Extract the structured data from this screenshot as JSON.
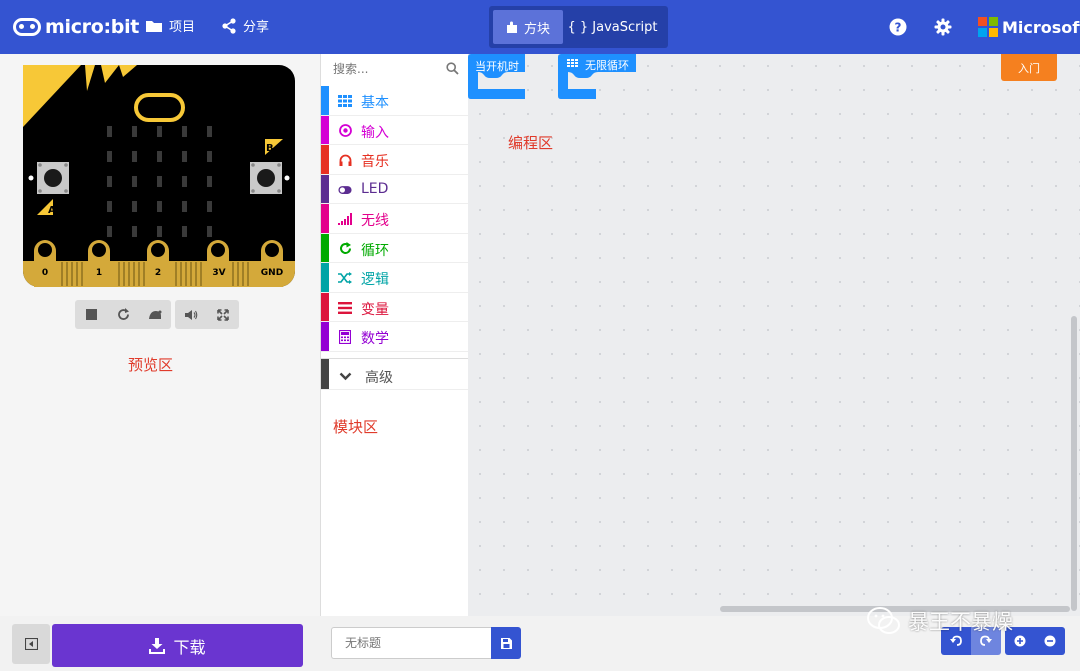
{
  "header": {
    "logo_text": "micro:bit",
    "nav_projects": "项目",
    "nav_share": "分享",
    "toggle_blocks": "方块",
    "toggle_js": "{ } JavaScript",
    "microsoft": "Microsoft",
    "colors": {
      "bar": "#3454d1",
      "toggle_bg": "#2540a8",
      "toggle_active": "#5c72d9"
    }
  },
  "simulator": {
    "pins": [
      "0",
      "1",
      "2",
      "3V",
      "GND"
    ],
    "button_a": "A",
    "button_b": "B",
    "label": "预览区",
    "controls": [
      "stop-icon",
      "restart-icon",
      "slowmo-icon",
      "mute-icon",
      "fullscreen-icon"
    ]
  },
  "toolbox": {
    "search_placeholder": "搜索...",
    "categories": [
      {
        "label": "基本",
        "color": "#1e90ff",
        "icon": "grid-icon"
      },
      {
        "label": "输入",
        "color": "#d400d4",
        "icon": "target-icon"
      },
      {
        "label": "音乐",
        "color": "#e63022",
        "icon": "headphones-icon"
      },
      {
        "label": "LED",
        "color": "#5c2d91",
        "icon": "toggle-icon"
      },
      {
        "label": "无线",
        "color": "#e3008c",
        "icon": "signal-icon"
      },
      {
        "label": "循环",
        "color": "#00aa00",
        "icon": "refresh-icon"
      },
      {
        "label": "逻辑",
        "color": "#00a4a6",
        "icon": "shuffle-icon"
      },
      {
        "label": "变量",
        "color": "#dc143c",
        "icon": "list-icon"
      },
      {
        "label": "数学",
        "color": "#9400d3",
        "icon": "calculator-icon"
      }
    ],
    "advanced_label": "高级",
    "label": "模块区"
  },
  "workspace": {
    "on_start": "当开机时",
    "forever": "无限循环",
    "get_started": "入门",
    "label": "编程区",
    "block_color": "#1e90ff"
  },
  "bottom": {
    "download_label": "下载",
    "project_name_placeholder": "无标题",
    "download_color": "#6a35d0"
  },
  "watermark": "暴王不暴燥"
}
